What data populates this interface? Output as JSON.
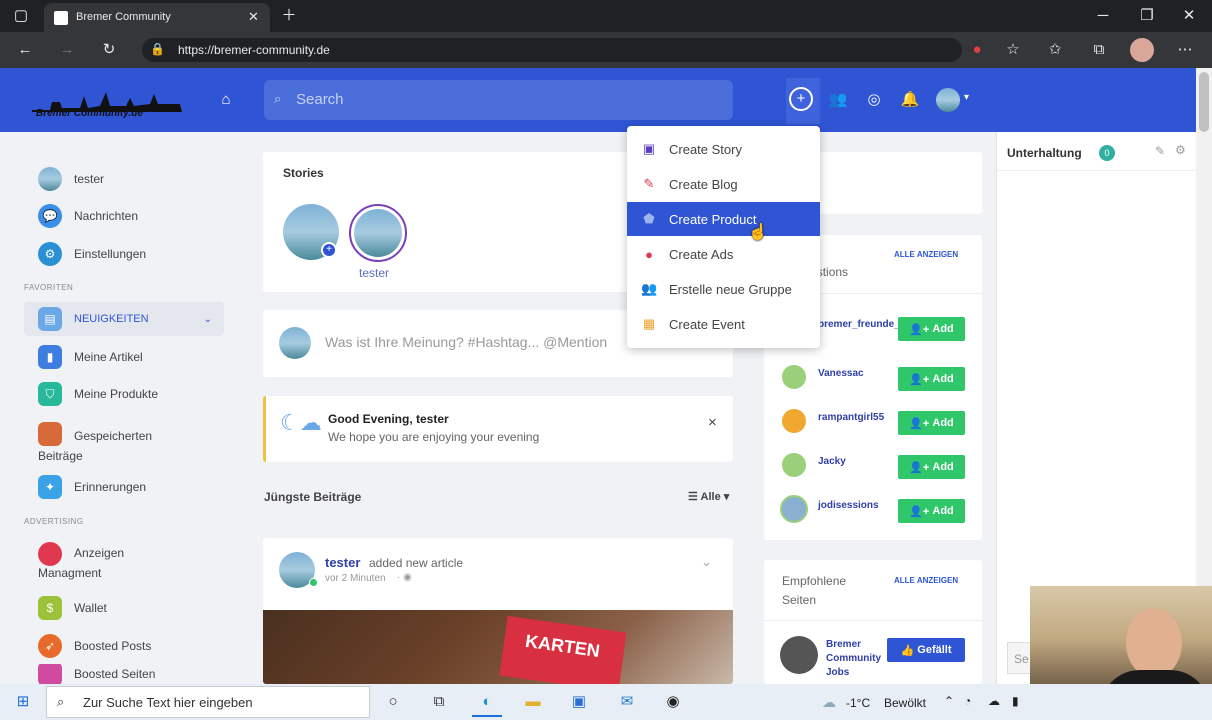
{
  "browser": {
    "tab_title": "Bremer Community",
    "url": "https://bremer-community.de"
  },
  "header": {
    "logo_text": "Bremer Community.de",
    "search_placeholder": "Search"
  },
  "sidebar": {
    "items_top": [
      {
        "label": "tester"
      },
      {
        "label": "Nachrichten"
      },
      {
        "label": "Einstellungen"
      }
    ],
    "section_favorites": "FAVORITEN",
    "items_fav": [
      {
        "label": "NEUIGKEITEN"
      },
      {
        "label": "Meine Artikel"
      },
      {
        "label": "Meine Produkte"
      },
      {
        "label": "Gespeicherten Beiträge"
      },
      {
        "label": "Erinnerungen"
      }
    ],
    "section_advertising": "ADVERTISING",
    "items_adv": [
      {
        "label": "Anzeigen Managment"
      },
      {
        "label": "Wallet"
      },
      {
        "label": "Boosted Posts"
      },
      {
        "label": "Boosted Seiten"
      }
    ]
  },
  "stories": {
    "title": "Stories",
    "user_label": "tester"
  },
  "composer": {
    "placeholder": "Was ist Ihre Meinung? #Hashtag... @Mention"
  },
  "greeting": {
    "title": "Good Evening, tester",
    "subtitle": "We hope you are enjoying your evening",
    "close": "×"
  },
  "feed": {
    "title": "Jüngste Beiträge",
    "filter": "Alle"
  },
  "post": {
    "user": "tester",
    "action": "added new article",
    "time": "vor 2 Minuten",
    "image_text": "KARTEN"
  },
  "dropdown": {
    "items": [
      {
        "label": "Create Story",
        "icon": "image-icon",
        "color": "#5b3cc4"
      },
      {
        "label": "Create Blog",
        "icon": "blog-icon",
        "color": "#e0394f"
      },
      {
        "label": "Create Product",
        "icon": "product-icon",
        "color": "#ffffff"
      },
      {
        "label": "Create Ads",
        "icon": "ads-icon",
        "color": "#e0394f"
      },
      {
        "label": "Erstelle neue Gruppe",
        "icon": "group-icon",
        "color": "#3a58c8"
      },
      {
        "label": "Create Event",
        "icon": "event-icon",
        "color": "#f0a030"
      }
    ]
  },
  "suggestions": {
    "title": "Suggestions",
    "show_all": "ALLE ANZEIGEN",
    "add_label": "Add",
    "users": [
      {
        "name": "bremer_freunde_ezni"
      },
      {
        "name": "Vanessac"
      },
      {
        "name": "rampantgirl55"
      },
      {
        "name": "Jacky"
      },
      {
        "name": "jodisessions"
      }
    ]
  },
  "pages": {
    "title": "Empfohlene Seiten",
    "show_all": "ALLE ANZEIGEN",
    "page_name": "Bremer Community Jobs",
    "like_label": "Gefällt"
  },
  "chat": {
    "title": "Unterhaltung",
    "count": "0",
    "search_partial": "Se"
  },
  "taskbar": {
    "search_placeholder": "Zur Suche Text hier eingeben",
    "weather": "-1°C",
    "weather_desc": "Bewölkt"
  }
}
